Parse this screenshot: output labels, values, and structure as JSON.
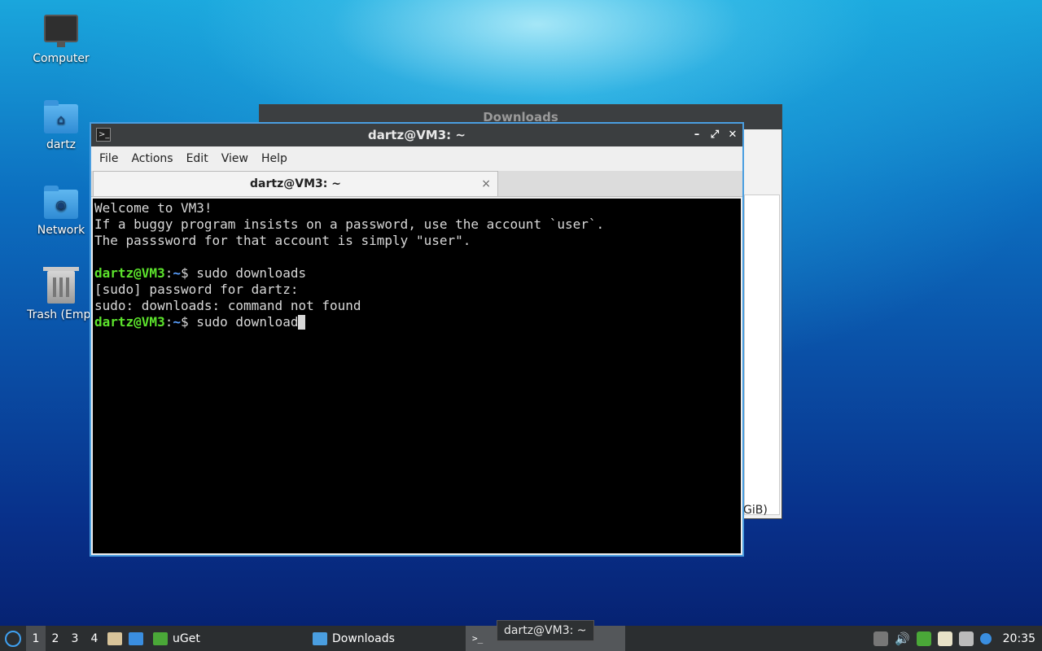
{
  "desktop": {
    "icons": [
      {
        "label": "Computer",
        "glyph": "computer-icon"
      },
      {
        "label": "dartz",
        "glyph": "home-folder-icon"
      },
      {
        "label": "Network",
        "glyph": "network-folder-icon"
      },
      {
        "label": "Trash (Empt",
        "glyph": "trash-icon"
      }
    ]
  },
  "background_window": {
    "title": "Downloads",
    "size_fragment": "GiB)"
  },
  "terminal": {
    "title": "dartz@VM3: ~",
    "menu": [
      "File",
      "Actions",
      "Edit",
      "View",
      "Help"
    ],
    "tab_label": "dartz@VM3: ~",
    "tab_close": "×",
    "lines": [
      "Welcome to VM3!",
      "If a buggy program insists on a password, use the account `user`.",
      "The passsword for that account is simply \"user\".",
      "",
      "[sudo] password for dartz:",
      "sudo: downloads: command not found"
    ],
    "prompt_user": "dartz@VM3",
    "prompt_sep": ":",
    "prompt_dir": "~",
    "prompt_dollar": "$ ",
    "cmd1": "sudo downloads",
    "cmd2": "sudo download"
  },
  "taskbar": {
    "workspaces": [
      "1",
      "2",
      "3",
      "4"
    ],
    "tasks": [
      {
        "label": "uGet"
      },
      {
        "label": "Downloads"
      },
      {
        "label": ""
      }
    ],
    "tooltip": "dartz@VM3: ~",
    "clock": "20:35"
  },
  "colors": {
    "prompt_green": "#5ce32c",
    "prompt_blue": "#5aa0ff",
    "window_border": "#4a9ee0"
  }
}
